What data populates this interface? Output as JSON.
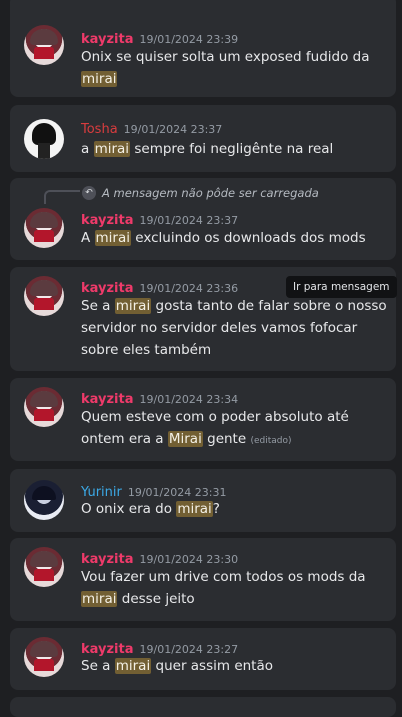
{
  "messages": [
    {
      "author": "kayzita",
      "time": "19/01/2024 23:39",
      "parts": [
        "Onix se quiser solta um exposed fudido da ",
        "mirai",
        ""
      ]
    },
    {
      "author": "Tosha",
      "time": "19/01/2024 23:37",
      "parts": [
        "a ",
        "mirai",
        " sempre foi negligênte na real"
      ]
    },
    {
      "author": "kayzita",
      "time": "19/01/2024 23:37",
      "reply": "A mensagem não pôde ser carregada",
      "parts": [
        "A ",
        "mirai",
        " excluindo os downloads dos mods"
      ]
    },
    {
      "author": "kayzita",
      "time": "19/01/2024 23:36",
      "parts": [
        "Se a ",
        "mirai",
        " gosta tanto de falar sobre o nosso servidor no servidor deles vamos fofocar sobre eles também"
      ]
    },
    {
      "author": "kayzita",
      "time": "19/01/2024 23:34",
      "parts": [
        "Quem esteve com o poder absoluto até ontem era a ",
        "Mirai",
        " gente "
      ],
      "edited": "(editado)"
    },
    {
      "author": "Yurinir",
      "time": "19/01/2024 23:31",
      "parts": [
        "O onix era do ",
        "mirai",
        "?"
      ]
    },
    {
      "author": "kayzita",
      "time": "19/01/2024 23:30",
      "parts": [
        "Vou fazer um drive com todos os mods da ",
        "mirai",
        " desse jeito"
      ]
    },
    {
      "author": "kayzita",
      "time": "19/01/2024 23:27",
      "parts": [
        "Se a ",
        "mirai",
        " quer assim então"
      ]
    }
  ],
  "tooltip": "Ir para mensagem",
  "colors": {
    "kayzita": "#ef3a6a",
    "Tosha": "#d83c3e",
    "Yurinir": "#3ba9e6",
    "highlight": "#725f33"
  }
}
